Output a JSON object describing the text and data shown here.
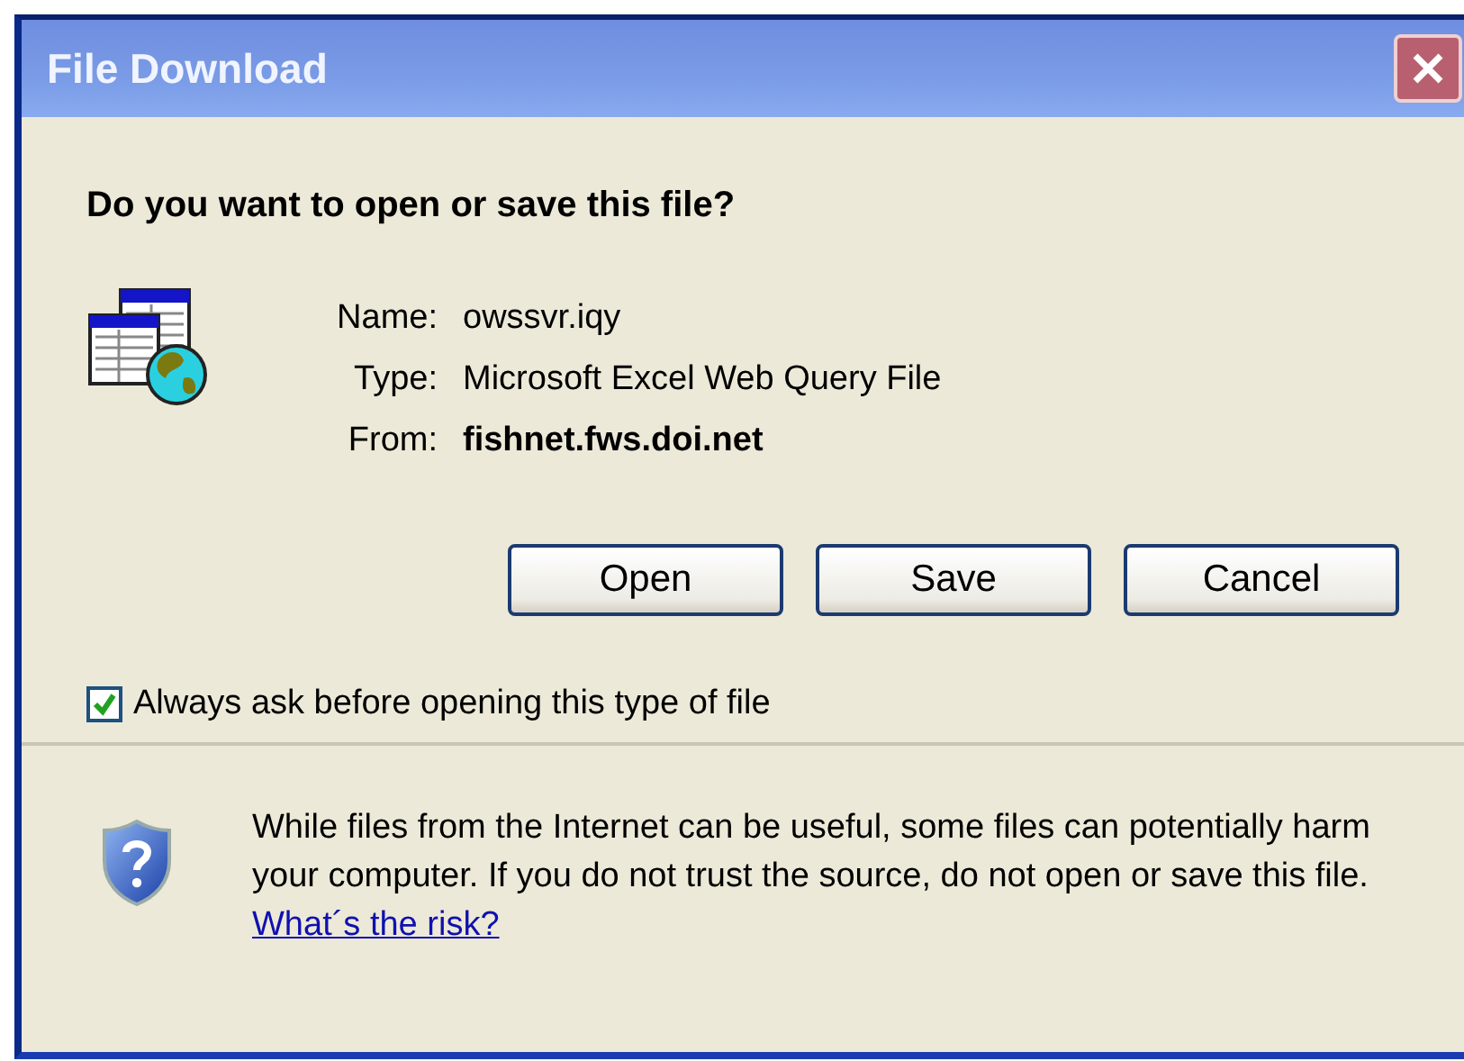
{
  "window": {
    "title": "File Download"
  },
  "question": "Do you want to open or save this file?",
  "file_info": [
    {
      "label": "Name:",
      "value": "owssvr.iqy",
      "bold": false
    },
    {
      "label": "Type:",
      "value": "Microsoft Excel Web Query File",
      "bold": false
    },
    {
      "label": "From:",
      "value": "fishnet.fws.doi.net",
      "bold": true
    }
  ],
  "buttons": [
    "Open",
    "Save",
    "Cancel"
  ],
  "always_ask": {
    "label": "Always ask before opening this type of file",
    "checked": true
  },
  "warning": {
    "text": "While files from the Internet can be useful, some files can potentially harm your computer. If you do not trust the source, do not open or save this file.",
    "link": "What´s the risk?"
  }
}
